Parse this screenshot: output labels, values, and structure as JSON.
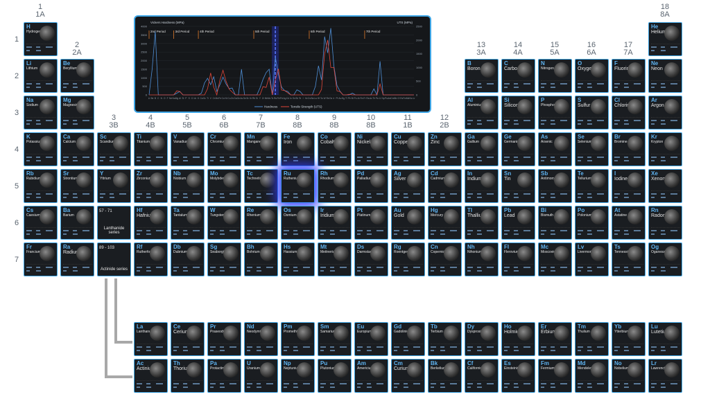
{
  "groups": [
    {
      "n": "1",
      "a": "1A",
      "col": 1,
      "y": 5
    },
    {
      "n": "2",
      "a": "2A",
      "col": 2,
      "y": 60
    },
    {
      "n": "3",
      "a": "3B",
      "col": 3,
      "y": 165
    },
    {
      "n": "4",
      "a": "4B",
      "col": 4,
      "y": 165
    },
    {
      "n": "5",
      "a": "5B",
      "col": 5,
      "y": 165
    },
    {
      "n": "6",
      "a": "6B",
      "col": 6,
      "y": 165
    },
    {
      "n": "7",
      "a": "7B",
      "col": 7,
      "y": 165
    },
    {
      "n": "8",
      "a": "8B",
      "col": 8,
      "y": 165
    },
    {
      "n": "9",
      "a": "8B",
      "col": 9,
      "y": 165
    },
    {
      "n": "10",
      "a": "8B",
      "col": 10,
      "y": 165
    },
    {
      "n": "11",
      "a": "1B",
      "col": 11,
      "y": 165
    },
    {
      "n": "12",
      "a": "2B",
      "col": 12,
      "y": 165
    },
    {
      "n": "13",
      "a": "3A",
      "col": 13,
      "y": 60
    },
    {
      "n": "14",
      "a": "4A",
      "col": 14,
      "y": 60
    },
    {
      "n": "15",
      "a": "5A",
      "col": 15,
      "y": 60
    },
    {
      "n": "16",
      "a": "6A",
      "col": 16,
      "y": 60
    },
    {
      "n": "17",
      "a": "7A",
      "col": 17,
      "y": 60
    },
    {
      "n": "18",
      "a": "8A",
      "col": 18,
      "y": 5
    }
  ],
  "periods": [
    "1",
    "2",
    "3",
    "4",
    "5",
    "6",
    "7"
  ],
  "elements": [
    [
      "H",
      "Hydrogen",
      1,
      1
    ],
    [
      "He",
      "Helium",
      18,
      1
    ],
    [
      "Li",
      "Lithium",
      1,
      2
    ],
    [
      "Be",
      "Beryllium",
      2,
      2
    ],
    [
      "B",
      "Boron",
      13,
      2
    ],
    [
      "C",
      "Carbon",
      14,
      2
    ],
    [
      "N",
      "Nitrogen",
      15,
      2
    ],
    [
      "O",
      "Oxygen",
      16,
      2
    ],
    [
      "F",
      "Fluorine",
      17,
      2
    ],
    [
      "Ne",
      "Neon",
      18,
      2
    ],
    [
      "Na",
      "Sodium",
      1,
      3
    ],
    [
      "Mg",
      "Magnesium",
      2,
      3
    ],
    [
      "Al",
      "Aluminium",
      13,
      3
    ],
    [
      "Si",
      "Silicon",
      14,
      3
    ],
    [
      "P",
      "Phosphorus",
      15,
      3
    ],
    [
      "S",
      "Sulfur",
      16,
      3
    ],
    [
      "Cl",
      "Chlorine",
      17,
      3
    ],
    [
      "Ar",
      "Argon",
      18,
      3
    ],
    [
      "K",
      "Potassium",
      1,
      4
    ],
    [
      "Ca",
      "Calcium",
      2,
      4
    ],
    [
      "Sc",
      "Scandium",
      3,
      4
    ],
    [
      "Ti",
      "Titanium",
      4,
      4
    ],
    [
      "V",
      "Vanadium",
      5,
      4
    ],
    [
      "Cr",
      "Chromium",
      6,
      4
    ],
    [
      "Mn",
      "Manganese",
      7,
      4
    ],
    [
      "Fe",
      "Iron",
      8,
      4
    ],
    [
      "Co",
      "Cobalt",
      9,
      4
    ],
    [
      "Ni",
      "Nickel",
      10,
      4
    ],
    [
      "Cu",
      "Copper",
      11,
      4
    ],
    [
      "Zn",
      "Zinc",
      12,
      4
    ],
    [
      "Ga",
      "Gallium",
      13,
      4
    ],
    [
      "Ge",
      "Germanium",
      14,
      4
    ],
    [
      "As",
      "Arsenic",
      15,
      4
    ],
    [
      "Se",
      "Selenium",
      16,
      4
    ],
    [
      "Br",
      "Bromine",
      17,
      4
    ],
    [
      "Kr",
      "Krypton",
      18,
      4
    ],
    [
      "Rb",
      "Rubidium",
      1,
      5
    ],
    [
      "Sr",
      "Strontium",
      2,
      5
    ],
    [
      "Y",
      "Yttrium",
      3,
      5
    ],
    [
      "Zr",
      "Zirconium",
      4,
      5
    ],
    [
      "Nb",
      "Niobium",
      5,
      5
    ],
    [
      "Mo",
      "Molybdenum",
      6,
      5
    ],
    [
      "Tc",
      "Technetium",
      7,
      5
    ],
    [
      "Ru",
      "Ruthenium",
      8,
      5
    ],
    [
      "Rh",
      "Rhodium",
      9,
      5
    ],
    [
      "Pd",
      "Palladium",
      10,
      5
    ],
    [
      "Ag",
      "Silver",
      11,
      5
    ],
    [
      "Cd",
      "Cadmium",
      12,
      5
    ],
    [
      "In",
      "Indium",
      13,
      5
    ],
    [
      "Sn",
      "Tin",
      14,
      5
    ],
    [
      "Sb",
      "Antimony",
      15,
      5
    ],
    [
      "Te",
      "Tellurium",
      16,
      5
    ],
    [
      "I",
      "Iodine",
      17,
      5
    ],
    [
      "Xe",
      "Xenon",
      18,
      5
    ],
    [
      "Cs",
      "Caesium",
      1,
      6
    ],
    [
      "Ba",
      "Barium",
      2,
      6
    ],
    [
      "Hf",
      "Hafnium",
      4,
      6
    ],
    [
      "Ta",
      "Tantalum",
      5,
      6
    ],
    [
      "W",
      "Tungsten",
      6,
      6
    ],
    [
      "Re",
      "Rhenium",
      7,
      6
    ],
    [
      "Os",
      "Osmium",
      8,
      6
    ],
    [
      "Ir",
      "Iridium",
      9,
      6
    ],
    [
      "Pt",
      "Platinum",
      10,
      6
    ],
    [
      "Au",
      "Gold",
      11,
      6
    ],
    [
      "Hg",
      "Mercury",
      12,
      6
    ],
    [
      "Tl",
      "Thallium",
      13,
      6
    ],
    [
      "Pb",
      "Lead",
      14,
      6
    ],
    [
      "Bi",
      "Bismuth",
      15,
      6
    ],
    [
      "Po",
      "Polonium",
      16,
      6
    ],
    [
      "At",
      "Astatine",
      17,
      6
    ],
    [
      "Rn",
      "Radon",
      18,
      6
    ],
    [
      "Fr",
      "Francium",
      1,
      7
    ],
    [
      "Ra",
      "Radium",
      2,
      7
    ],
    [
      "Rf",
      "Rutherfordium",
      4,
      7
    ],
    [
      "Db",
      "Dubnium",
      5,
      7
    ],
    [
      "Sg",
      "Seaborgium",
      6,
      7
    ],
    [
      "Bh",
      "Bohrium",
      7,
      7
    ],
    [
      "Hs",
      "Hassium",
      8,
      7
    ],
    [
      "Mt",
      "Meitnerium",
      9,
      7
    ],
    [
      "Ds",
      "Darmstadtium",
      10,
      7
    ],
    [
      "Rg",
      "Roentgenium",
      11,
      7
    ],
    [
      "Cn",
      "Copernicium",
      12,
      7
    ],
    [
      "Nh",
      "Nihonium",
      13,
      7
    ],
    [
      "Fl",
      "Flerovium",
      14,
      7
    ],
    [
      "Mc",
      "Moscovium",
      15,
      7
    ],
    [
      "Lv",
      "Livermorium",
      16,
      7
    ],
    [
      "Ts",
      "Tennessine",
      17,
      7
    ],
    [
      "Og",
      "Oganesson",
      18,
      7
    ],
    [
      "La",
      "Lanthanum",
      4,
      9
    ],
    [
      "Ce",
      "Cerium",
      5,
      9
    ],
    [
      "Pr",
      "Praseodymium",
      6,
      9
    ],
    [
      "Nd",
      "Neodymium",
      7,
      9
    ],
    [
      "Pm",
      "Promethium",
      8,
      9
    ],
    [
      "Sm",
      "Samarium",
      9,
      9
    ],
    [
      "Eu",
      "Europium",
      10,
      9
    ],
    [
      "Gd",
      "Gadolinium",
      11,
      9
    ],
    [
      "Tb",
      "Terbium",
      12,
      9
    ],
    [
      "Dy",
      "Dysprosium",
      13,
      9
    ],
    [
      "Ho",
      "Holmium",
      14,
      9
    ],
    [
      "Er",
      "Erbium",
      15,
      9
    ],
    [
      "Tm",
      "Thulium",
      16,
      9
    ],
    [
      "Yb",
      "Ytterbium",
      17,
      9
    ],
    [
      "Lu",
      "Lutetium",
      18,
      9
    ],
    [
      "Ac",
      "Actinium",
      4,
      10
    ],
    [
      "Th",
      "Thorium",
      5,
      10
    ],
    [
      "Pa",
      "Protactinium",
      6,
      10
    ],
    [
      "U",
      "Uranium",
      7,
      10
    ],
    [
      "Np",
      "Neptunium",
      8,
      10
    ],
    [
      "Pu",
      "Plutonium",
      9,
      10
    ],
    [
      "Am",
      "Americium",
      10,
      10
    ],
    [
      "Cm",
      "Curium",
      11,
      10
    ],
    [
      "Bk",
      "Berkelium",
      12,
      10
    ],
    [
      "Cf",
      "Californium",
      13,
      10
    ],
    [
      "Es",
      "Einsteinium",
      14,
      10
    ],
    [
      "Fm",
      "Fermium",
      15,
      10
    ],
    [
      "Md",
      "Mendelevium",
      16,
      10
    ],
    [
      "No",
      "Nobelium",
      17,
      10
    ],
    [
      "Lr",
      "Lawrencium",
      18,
      10
    ]
  ],
  "big_names": [
    "Iron",
    "Gold",
    "Lead",
    "Tin",
    "Silicon",
    "Neon",
    "Argon",
    "Xenon",
    "Radon",
    "Iodine",
    "Zinc",
    "Copper",
    "Silver",
    "Indium",
    "Iridium",
    "Radium",
    "Cerium",
    "Erbium",
    "Curium",
    "Thorium",
    "Actinium",
    "Oxygen",
    "Helium",
    "Carbon",
    "Sulfur",
    "Nickel",
    "Cobalt",
    "Boron",
    "Fluorine",
    "Chlorine",
    "Lutetium",
    "Holmium",
    "Thallium",
    "Hafnium"
  ],
  "highlighted": "Ru",
  "series": {
    "lanthanide": {
      "range": "57 - 71",
      "title": "Lanthanide series"
    },
    "actinide": {
      "range": "89 - 103",
      "title": "Actinide series"
    }
  },
  "chart_data": {
    "type": "line",
    "ylabel_left": "Vickers Hardness (MPa)",
    "ylabel_right": "UTS (MPa)",
    "ylim_left": [
      0,
      4000
    ],
    "ylim_right": [
      0,
      2500
    ],
    "left_ticks": [
      "4000",
      "3500",
      "3000",
      "2500",
      "2000",
      "1500",
      "1000",
      "500",
      "0"
    ],
    "right_ticks": [
      "2500",
      "2000",
      "1500",
      "1000",
      "500",
      "0"
    ],
    "period_labels": [
      "2nd Period",
      "3rd Period",
      "4th Period",
      "5th Period",
      "6th Period",
      "7th Period"
    ],
    "legend": [
      "Hardness",
      "Tensile Strength (UTS)"
    ],
    "x": [
      "Li",
      "Be",
      "B",
      "C",
      "N",
      "O",
      "F",
      "Ne",
      "Na",
      "Mg",
      "Al",
      "Si",
      "P",
      "S",
      "Cl",
      "Ar",
      "K",
      "Ca",
      "Sc",
      "Ti",
      "V",
      "Cr",
      "Mn",
      "Fe",
      "Co",
      "Ni",
      "Cu",
      "Zn",
      "Ga",
      "Ge",
      "As",
      "Se",
      "Br",
      "Kr",
      "Rb",
      "Sr",
      "Y",
      "Zr",
      "Nb",
      "Mo",
      "Tc",
      "Ru",
      "Rh",
      "Pd",
      "Ag",
      "Cd",
      "In",
      "Sn",
      "Sb",
      "Te",
      "I",
      "Xe",
      "Cs",
      "Ba",
      "La",
      "Hf",
      "Ta",
      "W",
      "Re",
      "Os",
      "Ir",
      "Pt",
      "Au",
      "Hg",
      "Tl",
      "Pb",
      "Bi",
      "Po",
      "At",
      "Rn",
      "Fr",
      "Ra",
      "Ac",
      "Th",
      "Pa",
      "U",
      "Np",
      "Pu",
      "Am",
      "Cm",
      "Bk",
      "Cf",
      "Es",
      "Fm",
      "Md",
      "No",
      "Lr"
    ],
    "series": [
      {
        "name": "Hardness",
        "color": "#4f8fd6",
        "values": [
          0,
          1500,
          3700,
          0,
          0,
          0,
          0,
          0,
          0,
          100,
          200,
          0,
          0,
          0,
          0,
          0,
          0,
          100,
          700,
          970,
          600,
          1060,
          200,
          600,
          1040,
          640,
          370,
          400,
          0,
          0,
          1500,
          0,
          0,
          0,
          0,
          0,
          400,
          900,
          1300,
          1500,
          0,
          2200,
          1200,
          460,
          250,
          200,
          0,
          0,
          300,
          200,
          0,
          0,
          0,
          0,
          500,
          1700,
          870,
          3400,
          2450,
          3900,
          1700,
          550,
          210,
          0,
          0,
          0,
          100,
          0,
          0,
          0,
          0,
          0,
          0,
          350,
          0,
          1960,
          0,
          0,
          0,
          0,
          0,
          0,
          0,
          0,
          0,
          0,
          0
        ]
      },
      {
        "name": "Tensile Strength (UTS)",
        "color": "#e0473a",
        "values": [
          0,
          0,
          0,
          0,
          0,
          0,
          0,
          0,
          0,
          150,
          120,
          0,
          0,
          0,
          0,
          0,
          0,
          0,
          0,
          230,
          800,
          280,
          0,
          540,
          900,
          500,
          210,
          100,
          0,
          0,
          0,
          0,
          0,
          0,
          0,
          0,
          0,
          300,
          270,
          650,
          0,
          550,
          950,
          180,
          160,
          78,
          0,
          0,
          0,
          0,
          0,
          0,
          0,
          0,
          0,
          0,
          200,
          1500,
          2000,
          1000,
          1000,
          150,
          120,
          0,
          0,
          20,
          0,
          0,
          0,
          0,
          0,
          0,
          0,
          0,
          0,
          400,
          0,
          0,
          0,
          0,
          0,
          0,
          0,
          0,
          0,
          0,
          0
        ]
      }
    ]
  }
}
